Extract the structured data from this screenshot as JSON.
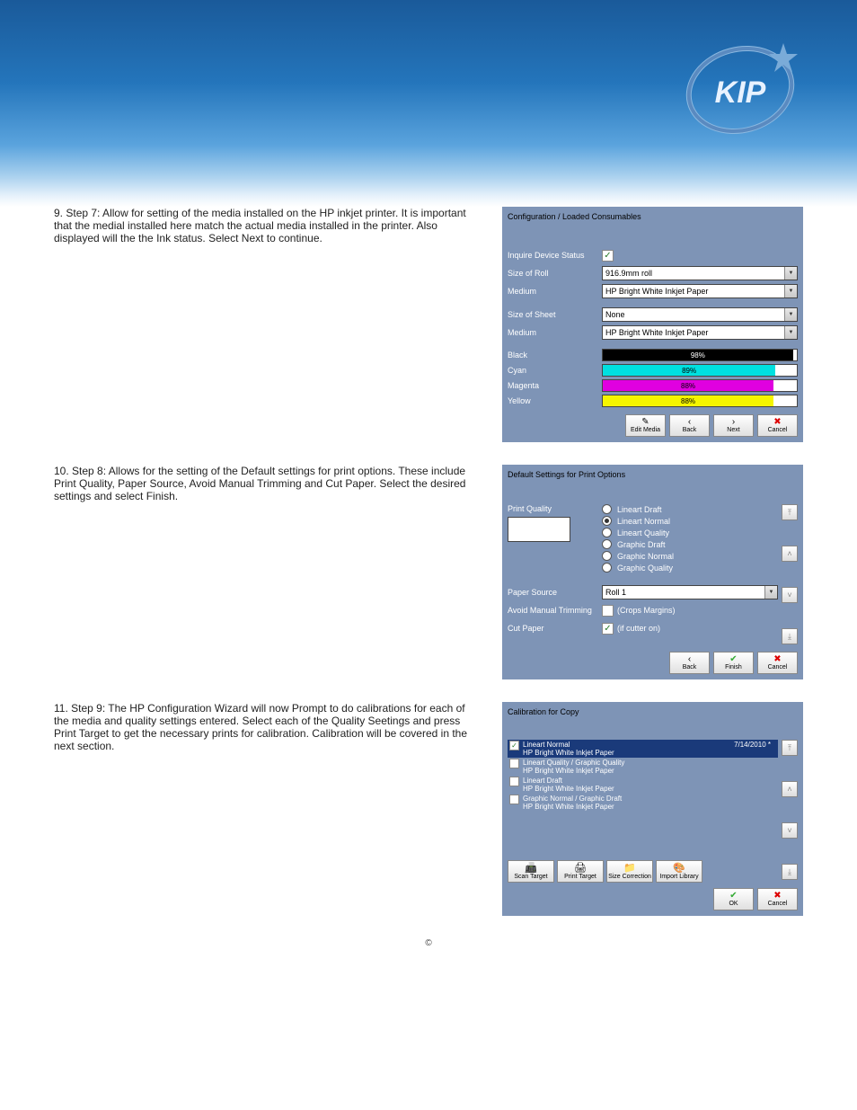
{
  "logo_text": "KIP",
  "steps": [
    {
      "num": "9.",
      "text": "Step 7: Allow for setting of the media installed on the HP inkjet printer. It is important that the medial installed here match the actual media installed in the printer. Also displayed will the the Ink status. Select Next to continue."
    },
    {
      "num": "10.",
      "text": "Step 8: Allows for the setting of the Default settings for print options. These include Print Quality, Paper Source, Avoid Manual Trimming and Cut Paper. Select the desired settings and select Finish."
    },
    {
      "num": "11.",
      "text": "Step 9: The HP Configuration Wizard will now Prompt to do calibrations for each of the media and quality settings entered. Select each of the Quality Seetings and press Print Target to get the necessary prints for calibration. Calibration will be covered in the next section."
    }
  ],
  "panel1": {
    "title": "Configuration / Loaded Consumables",
    "inquire": "Inquire Device Status",
    "size_roll_label": "Size of Roll",
    "size_roll_val": "916.9mm roll",
    "medium_label": "Medium",
    "medium1_val": "HP Bright White Inkjet Paper",
    "size_sheet_label": "Size of Sheet",
    "size_sheet_val": "None",
    "medium2_val": "HP Bright White Inkjet Paper",
    "inks": [
      {
        "name": "Black",
        "pct": "98%",
        "color": "#000",
        "text": "#fff",
        "w": "98%"
      },
      {
        "name": "Cyan",
        "pct": "89%",
        "color": "#00e0e0",
        "text": "#000",
        "w": "89%"
      },
      {
        "name": "Magenta",
        "pct": "88%",
        "color": "#e000e0",
        "text": "#000",
        "w": "88%"
      },
      {
        "name": "Yellow",
        "pct": "88%",
        "color": "#f5f500",
        "text": "#000",
        "w": "88%"
      }
    ],
    "btn_editmedia": "Edit Media",
    "btn_back": "Back",
    "btn_next": "Next",
    "btn_cancel": "Cancel"
  },
  "panel2": {
    "title": "Default Settings for Print Options",
    "print_quality": "Print Quality",
    "opts": [
      {
        "label": "Lineart Draft",
        "on": false
      },
      {
        "label": "Lineart Normal",
        "on": true
      },
      {
        "label": "Lineart Quality",
        "on": false
      },
      {
        "label": "Graphic Draft",
        "on": false
      },
      {
        "label": "Graphic Normal",
        "on": false
      },
      {
        "label": "Graphic Quality",
        "on": false
      }
    ],
    "paper_source_label": "Paper Source",
    "paper_source_val": "Roll 1",
    "avoid_trim_label": "Avoid Manual Trimming",
    "avoid_trim_note": "(Crops Margins)",
    "cut_paper_label": "Cut Paper",
    "cut_paper_note": "(if cutter on)",
    "btn_back": "Back",
    "btn_finish": "Finish",
    "btn_cancel": "Cancel"
  },
  "panel3": {
    "title": "Calibration for Copy",
    "items": [
      {
        "checked": true,
        "selected": true,
        "l1": "Lineart Normal",
        "l2": "HP Bright White Inkjet Paper",
        "date": "7/14/2010 *"
      },
      {
        "checked": false,
        "selected": false,
        "l1": "Lineart Quality / Graphic Quality",
        "l2": "HP Bright White Inkjet Paper"
      },
      {
        "checked": false,
        "selected": false,
        "l1": "Lineart Draft",
        "l2": "HP Bright White Inkjet Paper"
      },
      {
        "checked": false,
        "selected": false,
        "l1": "Graphic Normal / Graphic Draft",
        "l2": "HP Bright White Inkjet Paper"
      }
    ],
    "btn_scan": "Scan Target",
    "btn_print": "Print Target",
    "btn_size": "Size Correction",
    "btn_import": "Import Library",
    "btn_ok": "OK",
    "btn_cancel": "Cancel"
  },
  "footer_copyright": "©"
}
